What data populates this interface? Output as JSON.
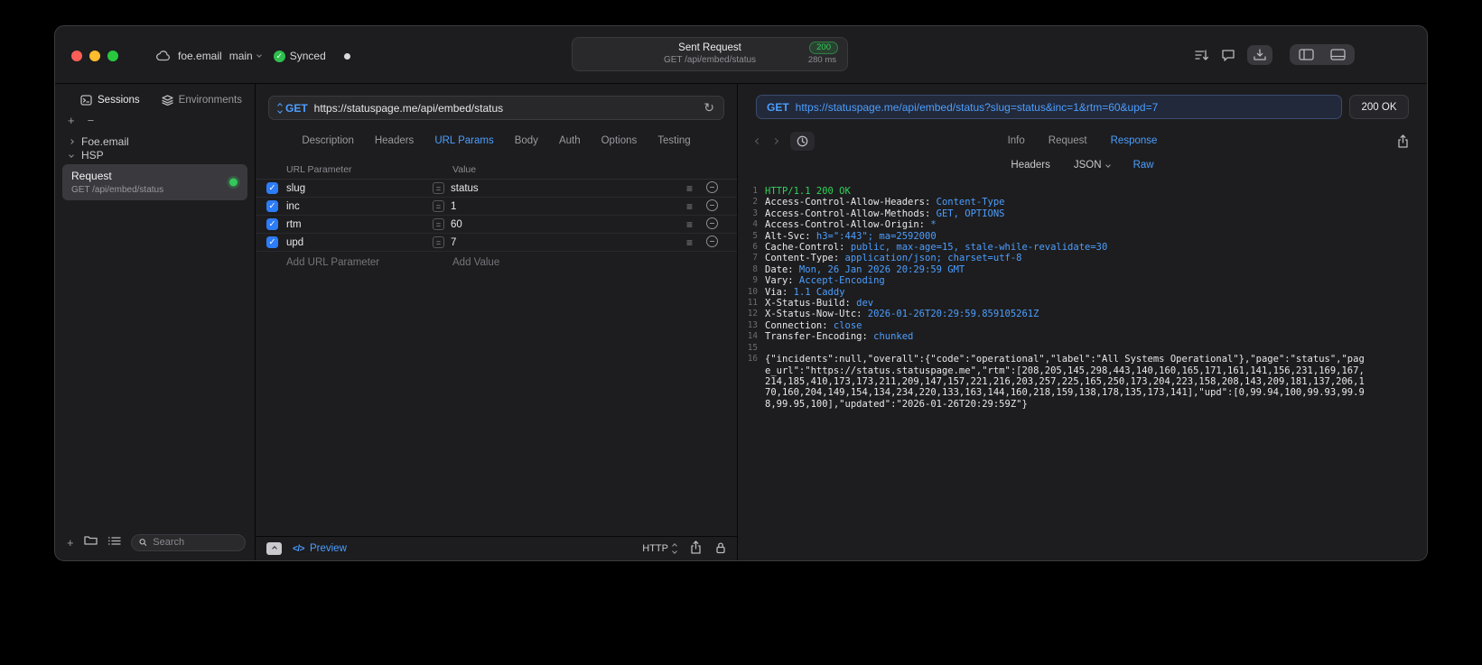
{
  "colors": {
    "accent_blue": "#4C9EFF",
    "status_green": "#30D158",
    "traffic_red": "#FF5F57",
    "traffic_yellow": "#FEBC2E",
    "traffic_green": "#28C840",
    "checkbox_blue": "#2D7CF7"
  },
  "icons": {
    "refresh": "↻",
    "hamburger": "≡",
    "equals": "=",
    "check": "✓",
    "plus": "+",
    "minus": "−",
    "preview_code": "</>"
  },
  "titlebar": {
    "project": "foe.email",
    "branch": "main",
    "sync_label": "Synced",
    "request_summary": {
      "title": "Sent Request",
      "status_code": "200",
      "method_path": "GET /api/embed/status",
      "duration": "280 ms"
    }
  },
  "sidebar": {
    "tabs": [
      "Sessions",
      "Environments"
    ],
    "active_tab": "Sessions",
    "tree": {
      "group1": "Foe.email",
      "group2": "HSP"
    },
    "request_item": {
      "title": "Request",
      "subtitle": "GET /api/embed/status"
    },
    "search_placeholder": "Search"
  },
  "request_pane": {
    "method": "GET",
    "url": "https://statuspage.me/api/embed/status",
    "tabs": [
      "Description",
      "Headers",
      "URL Params",
      "Body",
      "Auth",
      "Options",
      "Testing"
    ],
    "active_tab": "URL Params",
    "table": {
      "col_name": "URL Parameter",
      "col_value": "Value",
      "rows": [
        {
          "name": "slug",
          "value": "status"
        },
        {
          "name": "inc",
          "value": "1"
        },
        {
          "name": "rtm",
          "value": "60"
        },
        {
          "name": "upd",
          "value": "7"
        }
      ],
      "add_name": "Add URL Parameter",
      "add_value": "Add Value"
    },
    "footer": {
      "preview_label": "Preview",
      "protocol": "HTTP"
    }
  },
  "response_pane": {
    "method": "GET",
    "url": "https://statuspage.me/api/embed/status?slug=status&inc=1&rtm=60&upd=7",
    "status": "200 OK",
    "tabs": [
      "Info",
      "Request",
      "Response"
    ],
    "active_tab": "Response",
    "subtabs": [
      "Headers",
      "JSON",
      "Raw"
    ],
    "active_subtab": "Raw",
    "lines": [
      {
        "num": "1",
        "status": "HTTP/1.1 200 OK"
      },
      {
        "num": "2",
        "name": "Access-Control-Allow-Headers:",
        "value": " Content-Type"
      },
      {
        "num": "3",
        "name": "Access-Control-Allow-Methods:",
        "value": " GET, OPTIONS"
      },
      {
        "num": "4",
        "name": "Access-Control-Allow-Origin:",
        "value": " *"
      },
      {
        "num": "5",
        "name": "Alt-Svc:",
        "value": " h3=\":443\"; ma=2592000"
      },
      {
        "num": "6",
        "name": "Cache-Control:",
        "value": " public, max-age=15, stale-while-revalidate=30"
      },
      {
        "num": "7",
        "name": "Content-Type:",
        "value": " application/json; charset=utf-8"
      },
      {
        "num": "8",
        "name": "Date:",
        "value": " Mon, 26 Jan 2026 20:29:59 GMT"
      },
      {
        "num": "9",
        "name": "Vary:",
        "value": " Accept-Encoding"
      },
      {
        "num": "10",
        "name": "Via:",
        "value": " 1.1 Caddy"
      },
      {
        "num": "11",
        "name": "X-Status-Build:",
        "value": " dev"
      },
      {
        "num": "12",
        "name": "X-Status-Now-Utc:",
        "value": " 2026-01-26T20:29:59.859105261Z"
      },
      {
        "num": "13",
        "name": "Connection:",
        "value": " close"
      },
      {
        "num": "14",
        "name": "Transfer-Encoding:",
        "value": " chunked"
      },
      {
        "num": "15",
        "blank": true
      },
      {
        "num": "16",
        "body": "{\"incidents\":null,\"overall\":{\"code\":\"operational\",\"label\":\"All Systems Operational\"},\"page\":\"status\",\"page_url\":\"https://status.statuspage.me\",\"rtm\":[208,205,145,298,443,140,160,165,171,161,141,156,231,169,167,214,185,410,173,173,211,209,147,157,221,216,203,257,225,165,250,173,204,223,158,208,143,209,181,137,206,170,160,204,149,154,134,234,220,133,163,144,160,218,159,138,178,135,173,141],\"upd\":[0,99.94,100,99.93,99.98,99.95,100],\"updated\":\"2026-01-26T20:29:59Z\"}"
      }
    ]
  }
}
